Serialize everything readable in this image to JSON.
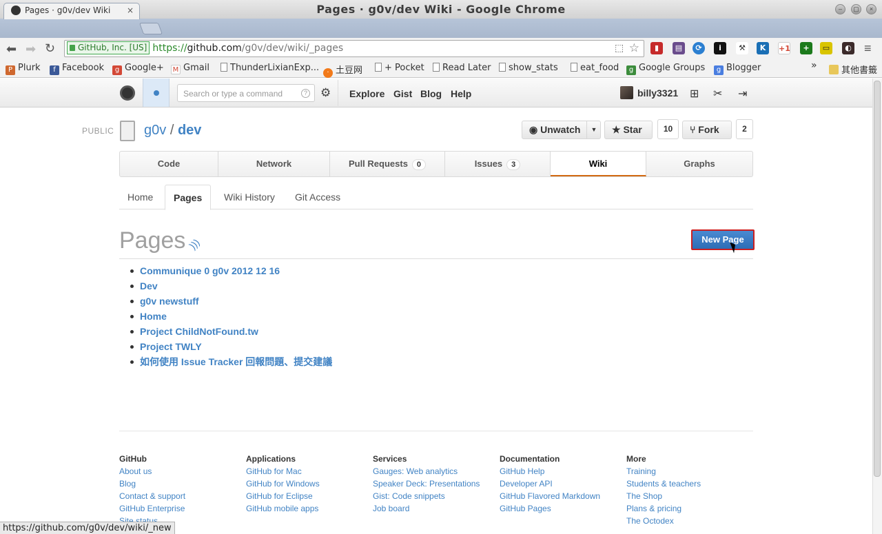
{
  "window": {
    "title": "Pages ·  g0v/dev Wiki - Google Chrome"
  },
  "tab": {
    "label": "Pages ·  g0v/dev Wiki",
    "close": "×"
  },
  "omnibox": {
    "ev_label": "GitHub, Inc. [US]",
    "scheme": "https://",
    "host": "github.com",
    "path": "/g0v/dev/wiki/_pages"
  },
  "bookmarks": [
    {
      "label": "Plurk",
      "icon": "plurk-icon",
      "color": "#cf682f"
    },
    {
      "label": "Facebook",
      "icon": "facebook-icon",
      "color": "#3b5998"
    },
    {
      "label": "Google+",
      "icon": "google-plus-icon",
      "color": "#d34836"
    },
    {
      "label": "Gmail",
      "icon": "gmail-icon",
      "color": "#d14836"
    },
    {
      "label": "ThunderLixianExp...",
      "icon": "page-icon",
      "color": ""
    },
    {
      "label": "土豆网",
      "icon": "tudou-icon",
      "color": "#f27a1a"
    },
    {
      "label": "+ Pocket",
      "icon": "page-icon",
      "color": ""
    },
    {
      "label": "Read Later",
      "icon": "page-icon",
      "color": ""
    },
    {
      "label": "show_stats",
      "icon": "page-icon",
      "color": ""
    },
    {
      "label": "eat_food",
      "icon": "page-icon",
      "color": ""
    },
    {
      "label": "Google Groups",
      "icon": "google-groups-icon",
      "color": "#3c8c3c"
    },
    {
      "label": "Blogger",
      "icon": "google-icon",
      "color": "#4a7ee0"
    }
  ],
  "bookmarks_more": "»",
  "other_bookmarks": "其他書籤",
  "header": {
    "search_placeholder": "Search or type a command",
    "nav": [
      "Explore",
      "Gist",
      "Blog",
      "Help"
    ],
    "username": "billy3321"
  },
  "repo": {
    "visibility": "PUBLIC",
    "owner": "g0v",
    "separator": "/",
    "name": "dev",
    "unwatch_label": "Unwatch",
    "star_label": "Star",
    "star_count": "10",
    "fork_label": "Fork",
    "fork_count": "2"
  },
  "repo_tabs": [
    {
      "label": "Code",
      "count": ""
    },
    {
      "label": "Network",
      "count": ""
    },
    {
      "label": "Pull Requests",
      "count": "0"
    },
    {
      "label": "Issues",
      "count": "3"
    },
    {
      "label": "Wiki",
      "count": ""
    },
    {
      "label": "Graphs",
      "count": ""
    }
  ],
  "wiki_tabs": [
    "Home",
    "Pages",
    "Wiki History",
    "Git Access"
  ],
  "page": {
    "title": "Pages",
    "new_page_label": "New Page",
    "items": [
      "Communique 0 g0v 2012 12 16",
      "Dev",
      "g0v newstuff",
      "Home",
      "Project ChildNotFound.tw",
      "Project TWLY",
      "如何使用 Issue Tracker 回報問題、提交建議"
    ]
  },
  "footer": {
    "columns": [
      {
        "heading": "GitHub",
        "links": [
          "About us",
          "Blog",
          "Contact & support",
          "GitHub Enterprise",
          "Site status"
        ]
      },
      {
        "heading": "Applications",
        "links": [
          "GitHub for Mac",
          "GitHub for Windows",
          "GitHub for Eclipse",
          "GitHub mobile apps"
        ]
      },
      {
        "heading": "Services",
        "links": [
          "Gauges: Web analytics",
          "Speaker Deck: Presentations",
          "Gist: Code snippets",
          "Job board"
        ]
      },
      {
        "heading": "Documentation",
        "links": [
          "GitHub Help",
          "Developer API",
          "GitHub Flavored Markdown",
          "GitHub Pages"
        ]
      },
      {
        "heading": "More",
        "links": [
          "Training",
          "Students & teachers",
          "The Shop",
          "Plans & pricing",
          "The Octodex"
        ]
      }
    ]
  },
  "status_url": "https://github.com/g0v/dev/wiki/_new",
  "colors": {
    "link": "#4183c4",
    "accent_tab": "#d26911",
    "button": "#2d6db5",
    "highlight": "#cc1f1f"
  }
}
